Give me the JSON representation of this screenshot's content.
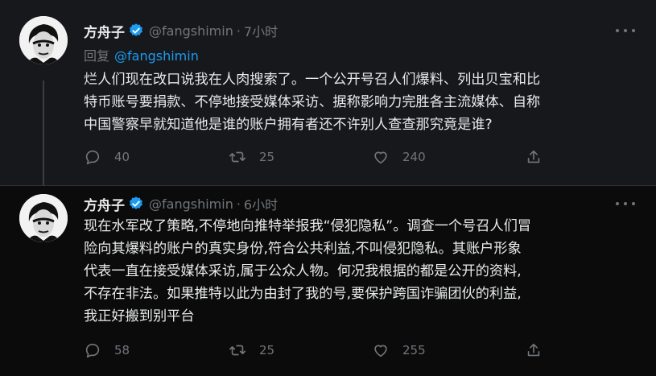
{
  "tweets": [
    {
      "name": "方舟子",
      "handle": "@fangshimin",
      "time": "7小时",
      "reply_label": "回复",
      "reply_handle": "@fangshimin",
      "text_lines": [
        "烂人们现在改口说我在人肉搜索了。一个公开号召人们爆料、列出贝宝和比",
        "特币账号要捐款、不停地接受媒体采访、据称影响力完胜各主流媒体、自称",
        "中国警察早就知道他是谁的账户拥有者还不许别人查查那究竟是谁?"
      ],
      "replies": "40",
      "retweets": "25",
      "likes": "240"
    },
    {
      "name": "方舟子",
      "handle": "@fangshimin",
      "time": "6小时",
      "text_lines": [
        "现在水军改了策略,不停地向推特举报我“侵犯隐私”。调查一个号召人们冒",
        "险向其爆料的账户的真实身份,符合公共利益,不叫侵犯隐私。其账户形象",
        "代表一直在接受媒体采访,属于公众人物。何况我根据的都是公开的资料,",
        "不存在非法。如果推特以此为由封了我的号,要保护跨国诈骗团伙的利益,",
        "我正好搬到别平台"
      ],
      "replies": "58",
      "retweets": "25",
      "likes": "255"
    }
  ],
  "icons": {
    "verified": "verified-badge-icon",
    "reply": "reply-icon",
    "retweet": "retweet-icon",
    "like": "heart-icon",
    "share": "share-icon",
    "more": "more-icon"
  },
  "colors": {
    "background": "#0b0b0b",
    "highlight_background": "#16181c",
    "text": "#e7e9ea",
    "muted": "#71767b",
    "accent": "#1d9bf0"
  }
}
